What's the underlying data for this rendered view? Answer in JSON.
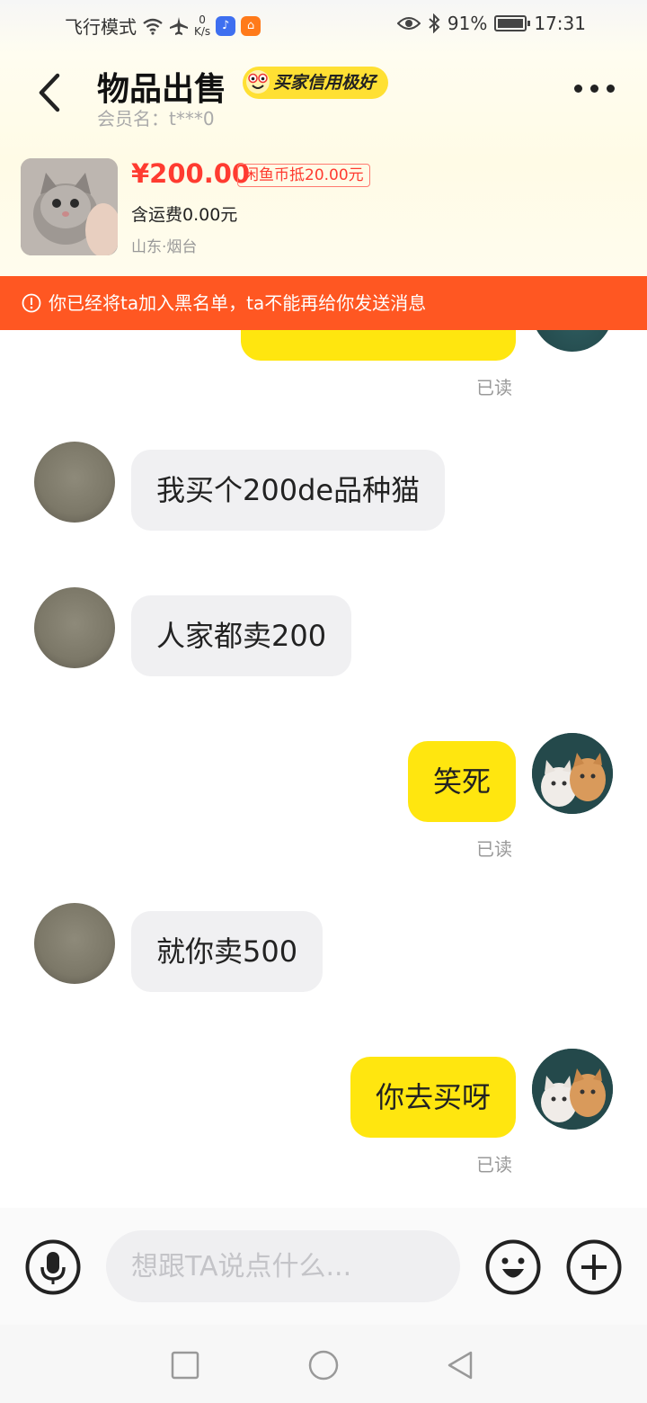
{
  "status_bar": {
    "mode_text": "飞行模式",
    "net_speed_value": "0",
    "net_speed_unit": "K/s",
    "battery_percent": "91%",
    "battery_level": 0.91,
    "time": "17:31"
  },
  "header": {
    "title": "物品出售",
    "credit_badge": "买家信用极好",
    "member_label": "会员名：",
    "member_name": "t***0"
  },
  "product": {
    "price": "¥200.00",
    "coin_discount": "闲鱼币抵20.00元",
    "shipping": "含运费0.00元",
    "location": "山东·烟台"
  },
  "banner": {
    "text": "你已经将ta加入黑名单，ta不能再给你发送消息"
  },
  "messages": {
    "read_label": "已读",
    "m1": "我买个200de品种猫",
    "m2": "人家都卖200",
    "m3": "笑死",
    "m4": "就你卖500",
    "m5": "你去买呀"
  },
  "input": {
    "placeholder": "想跟TA说点什么..."
  },
  "colors": {
    "accent_yellow": "#ffe60f",
    "banner_orange": "#ff5722",
    "price_red": "#ff3b30",
    "incoming_bubble": "#f0f0f2"
  }
}
